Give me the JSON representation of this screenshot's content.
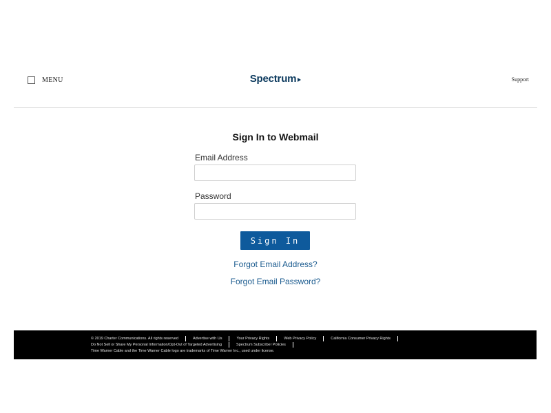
{
  "header": {
    "menu_label": "MENU",
    "logo_text": "Spectrum",
    "support_label": "Support"
  },
  "form": {
    "title": "Sign In to Webmail",
    "email_label": "Email Address",
    "email_value": "",
    "password_label": "Password",
    "password_value": "",
    "signin_label": "Sign In",
    "forgot_email_label": "Forgot Email Address?",
    "forgot_password_label": "Forgot Email Password?"
  },
  "footer": {
    "row1": [
      "© 2019 Charter Communications. All rights reserved",
      "Advertise with Us",
      "Your Privacy Rights",
      "Web Privacy Policy",
      "California Consumer Privacy Rights"
    ],
    "row2": [
      "Do Not Sell or Share My Personal Information/Opt-Out of Targeted Advertising",
      "Spectrum Subscriber Policies"
    ],
    "trademark_text": "Time Warner Cable and the Time Warner Cable logo are trademarks of Time Warner Inc., used under license."
  },
  "colors": {
    "brand_navy": "#0c3a5e",
    "button_blue": "#0e5a9c",
    "link_blue": "#1b5b8f",
    "footer_bg": "#000000"
  },
  "icons": {
    "menu": "menu-checkbox-icon",
    "logo": "spectrum-arrow-icon"
  }
}
